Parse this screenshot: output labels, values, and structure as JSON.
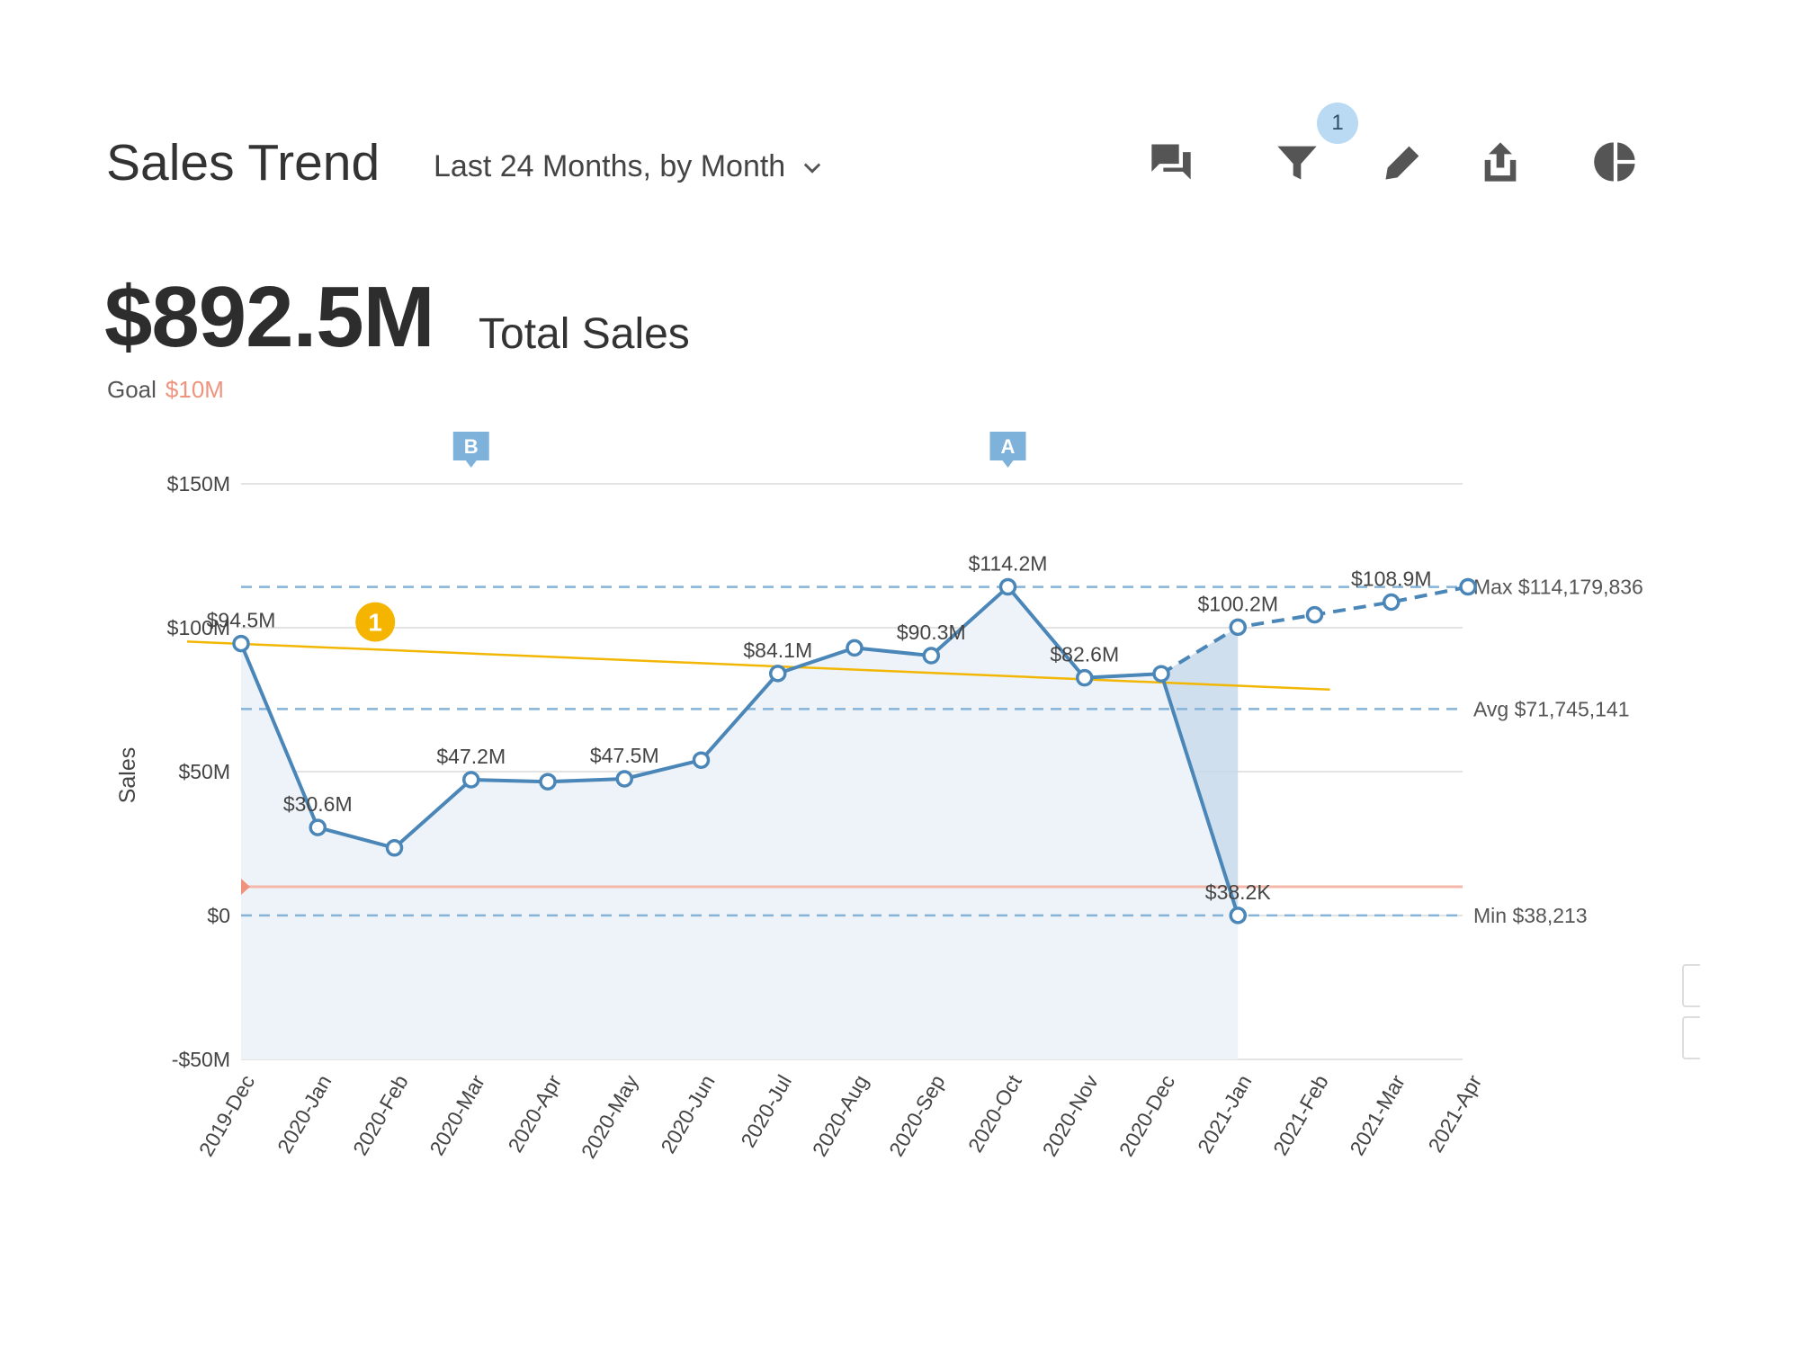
{
  "header": {
    "title": "Sales Trend",
    "range_label": "Last 24 Months, by Month",
    "filter_count": "1",
    "icons": [
      "comments-icon",
      "filter-icon",
      "pencil-icon",
      "share-icon",
      "pie-chart-icon"
    ]
  },
  "kpi": {
    "value": "$892.5M",
    "label": "Total Sales",
    "goal_label": "Goal",
    "goal_value": "$10M"
  },
  "colors": {
    "line": "#4a86b8",
    "forecast": "#4a86b8",
    "trend": "#f2b705",
    "goal": "#f4b8aa",
    "ref": "#86b3d8",
    "area": "#eef3f9",
    "marker_fill": "#5b9fd4"
  },
  "chart_data": {
    "type": "line",
    "ylabel": "Sales",
    "ylim": [
      -50,
      150
    ],
    "yticks": [
      {
        "value": -50,
        "label": "-$50M"
      },
      {
        "value": 0,
        "label": "$0"
      },
      {
        "value": 50,
        "label": "$50M"
      },
      {
        "value": 100,
        "label": "$100M"
      },
      {
        "value": 150,
        "label": "$150M"
      }
    ],
    "categories": [
      "2019-Dec",
      "2020-Jan",
      "2020-Feb",
      "2020-Mar",
      "2020-Apr",
      "2020-May",
      "2020-Jun",
      "2020-Jul",
      "2020-Aug",
      "2020-Sep",
      "2020-Oct",
      "2020-Nov",
      "2020-Dec",
      "2021-Jan",
      "2021-Feb",
      "2021-Mar",
      "2021-Apr"
    ],
    "series": [
      {
        "values": [
          94.5,
          30.6,
          23.5,
          47.2,
          46.5,
          47.5,
          54.0,
          84.1,
          93.0,
          90.3,
          114.2,
          82.6,
          84.0,
          0.0382
        ],
        "labels": [
          "$94.5M",
          "$30.6M",
          "",
          "$47.2M",
          "",
          "$47.5M",
          "",
          "$84.1M",
          "",
          "$90.3M",
          "$114.2M",
          "$82.6M",
          "",
          "$38.2K"
        ]
      },
      {
        "values": [
          100.2,
          104.5,
          108.9,
          114.2
        ],
        "start_index": 13,
        "labels": [
          "$100.2M",
          "",
          "$108.9M",
          ""
        ]
      }
    ],
    "trendline": {
      "from": [
        0,
        95.5
      ],
      "to": [
        14.2,
        78.5
      ]
    },
    "goal_line": 10,
    "reference_lines": [
      {
        "value": 114.18,
        "label": "Max $114,179,836"
      },
      {
        "value": 71.745,
        "label": "Avg $71,745,141"
      },
      {
        "value": 0.038,
        "label": "Min $38,213"
      }
    ],
    "annotations": [
      {
        "index": 3,
        "label": "B"
      },
      {
        "index": 10,
        "label": "A"
      }
    ],
    "callout": {
      "index": 1.75,
      "value": 102,
      "label": "1"
    },
    "grid": true
  }
}
